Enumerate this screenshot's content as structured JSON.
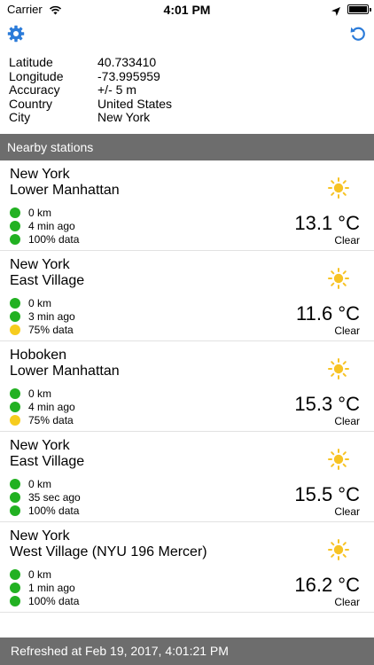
{
  "status_bar": {
    "carrier": "Carrier",
    "time": "4:01 PM"
  },
  "colors": {
    "accent": "#2b7bd9",
    "green": "#22b122",
    "yellow": "#f6cc1e",
    "sun": "#f7c325",
    "header_bg": "#6d6d6d"
  },
  "info": [
    {
      "label": "Latitude",
      "value": "40.733410"
    },
    {
      "label": "Longitude",
      "value": "-73.995959"
    },
    {
      "label": "Accuracy",
      "value": "+/- 5 m"
    },
    {
      "label": "Country",
      "value": "United States"
    },
    {
      "label": "City",
      "value": "New York"
    }
  ],
  "section_title": "Nearby stations",
  "stations": [
    {
      "city": "New York",
      "area": "Lower Manhattan",
      "distance": "0 km",
      "age": "4 min ago",
      "data": "100% data",
      "data_status": "green",
      "temp": "13.1 °C",
      "condition": "Clear"
    },
    {
      "city": "New York",
      "area": "East Village",
      "distance": "0 km",
      "age": "3 min ago",
      "data": "75% data",
      "data_status": "yellow",
      "temp": "11.6 °C",
      "condition": "Clear"
    },
    {
      "city": "Hoboken",
      "area": "Lower Manhattan",
      "distance": "0 km",
      "age": "4 min ago",
      "data": "75% data",
      "data_status": "yellow",
      "temp": "15.3 °C",
      "condition": "Clear"
    },
    {
      "city": "New York",
      "area": "East Village",
      "distance": "0 km",
      "age": "35 sec ago",
      "data": "100% data",
      "data_status": "green",
      "temp": "15.5 °C",
      "condition": "Clear"
    },
    {
      "city": "New York",
      "area": "West Village (NYU 196 Mercer)",
      "distance": "0 km",
      "age": "1 min ago",
      "data": "100% data",
      "data_status": "green",
      "temp": "16.2 °C",
      "condition": "Clear"
    }
  ],
  "footer": "Refreshed at Feb 19, 2017, 4:01:21 PM"
}
